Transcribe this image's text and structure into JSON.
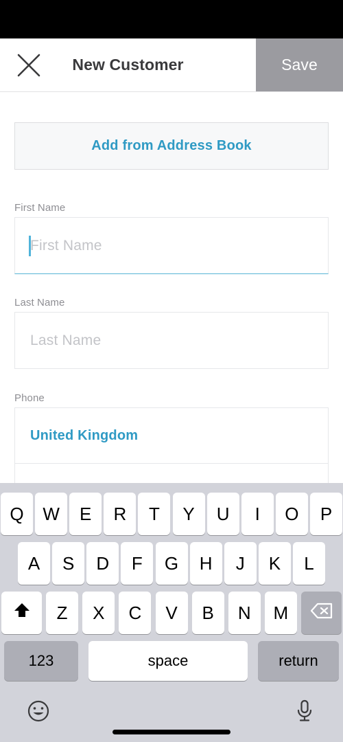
{
  "colors": {
    "accent": "#2f9ac4",
    "caret": "#4fb3da",
    "save_bg": "#9b9ba0",
    "label_gray": "#8e8e93",
    "placeholder_gray": "#c3c4c8",
    "keyboard_bg": "#d2d3da",
    "key_dark": "#adaeb6",
    "status_bar": "#000000"
  },
  "header": {
    "title": "New Customer",
    "close_icon": "close-x-icon",
    "save_label": "Save"
  },
  "form": {
    "address_book_button": "Add from Address Book",
    "fields": [
      {
        "label": "First Name",
        "placeholder": "First Name",
        "value": "",
        "focused": true
      },
      {
        "label": "Last Name",
        "placeholder": "Last Name",
        "value": "",
        "focused": false
      }
    ],
    "phone": {
      "label": "Phone",
      "country": "United Kingdom",
      "number": "",
      "number_placeholder": ""
    }
  },
  "keyboard": {
    "row1": [
      "Q",
      "W",
      "E",
      "R",
      "T",
      "Y",
      "U",
      "I",
      "O",
      "P"
    ],
    "row2": [
      "A",
      "S",
      "D",
      "F",
      "G",
      "H",
      "J",
      "K",
      "L"
    ],
    "row3_letters": [
      "Z",
      "X",
      "C",
      "V",
      "B",
      "N",
      "M"
    ],
    "shift_icon": "shift-arrow-icon",
    "backspace_icon": "backspace-delete-icon",
    "numeric_label": "123",
    "space_label": "space",
    "return_label": "return",
    "emoji_icon": "emoji-smiley-icon",
    "dictation_icon": "microphone-icon"
  }
}
